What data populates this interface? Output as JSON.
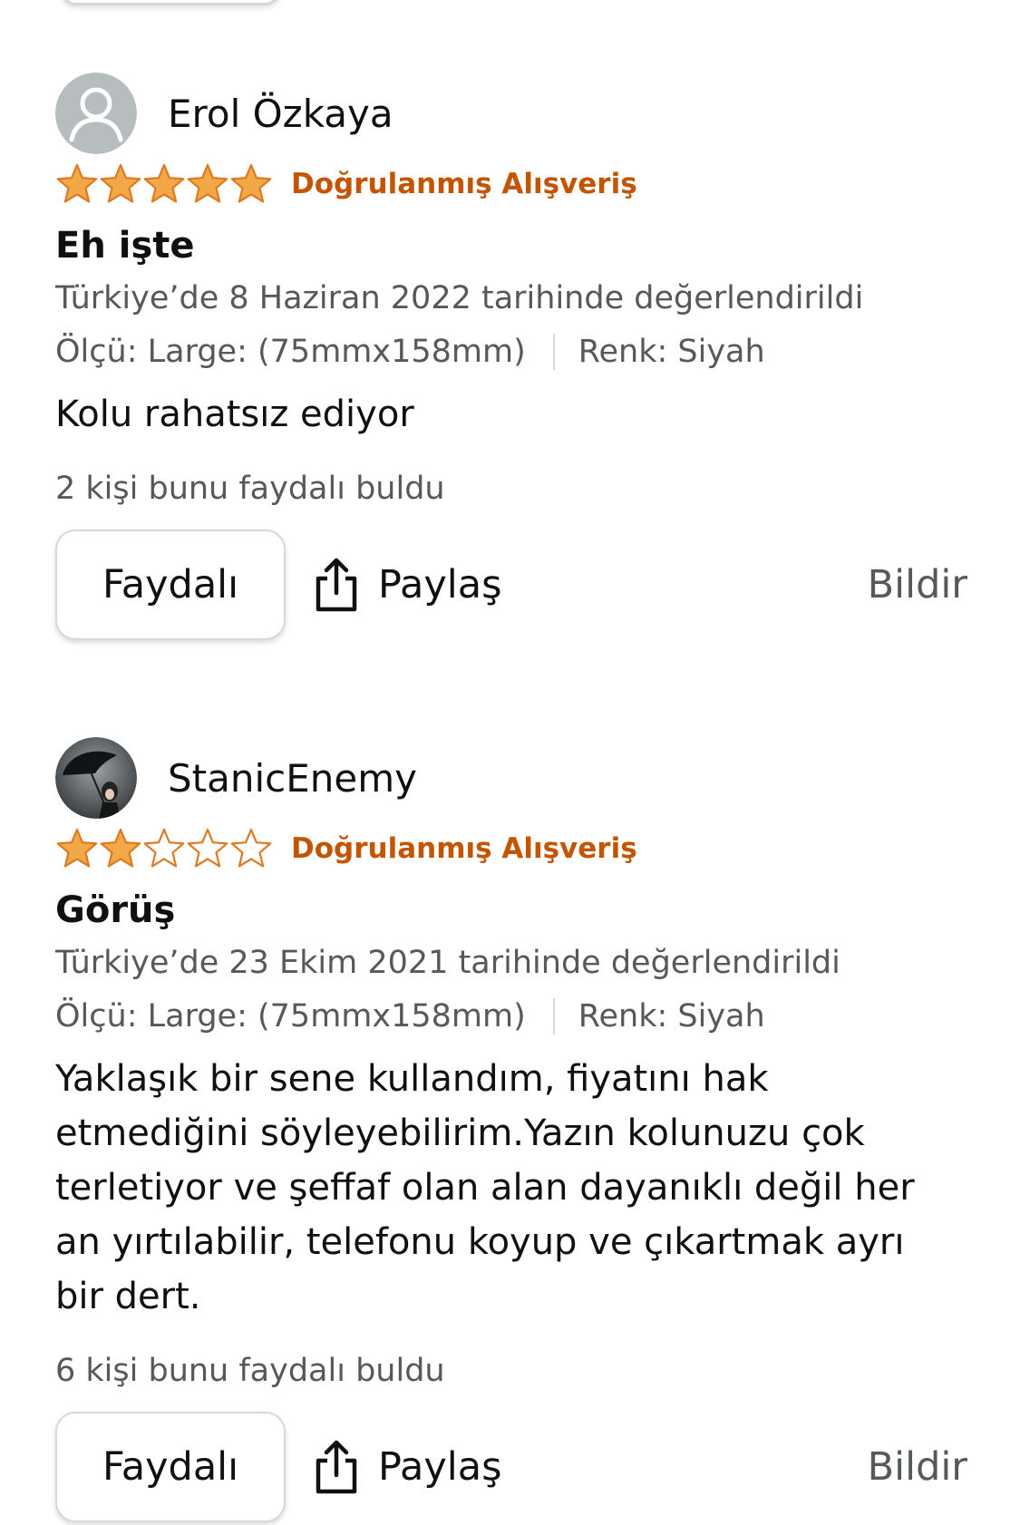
{
  "reviews": [
    {
      "reviewer_name": "Erol Özkaya",
      "avatar": "default-user-icon",
      "rating": 5,
      "rating_max": 5,
      "verified_label": "Doğrulanmış Alışveriş",
      "title": "Eh işte",
      "date_text": "Türkiye’de 8 Haziran 2022 tarihinde değerlendirildi",
      "size_text": "Ölçü: Large: (75mmx158mm)",
      "color_text": "Renk: Siyah",
      "body": "Kolu rahatsız ediyor",
      "helpful_text": "2 kişi bunu faydalı buldu",
      "helpful_button": "Faydalı",
      "share_label": "Paylaş",
      "report_label": "Bildir"
    },
    {
      "reviewer_name": "StanicEnemy",
      "avatar": "umbrella-photo-avatar",
      "rating": 2,
      "rating_max": 5,
      "verified_label": "Doğrulanmış Alışveriş",
      "title": "Görüş",
      "date_text": "Türkiye’de 23 Ekim 2021 tarihinde değerlendirildi",
      "size_text": "Ölçü: Large: (75mmx158mm)",
      "color_text": "Renk: Siyah",
      "body_lines": [
        "Yaklaşık bir sene kullandım, fiyatını hak",
        "etmediğini söyleyebilirim.Yazın kolunuzu çok",
        "terletiyor ve şeffaf olan alan dayanıklı değil her",
        "an yırtılabilir, telefonu koyup ve çıkartmak ayrı",
        "bir dert."
      ],
      "helpful_text": "6 kişi bunu faydalı buldu",
      "helpful_button": "Faydalı",
      "share_label": "Paylaş",
      "report_label": "Bildir"
    }
  ],
  "colors": {
    "star_fill": "#f3a847",
    "star_outline": "#de7921",
    "verified": "#c45500",
    "secondary_text": "#565959",
    "border": "#d5d9d9"
  }
}
